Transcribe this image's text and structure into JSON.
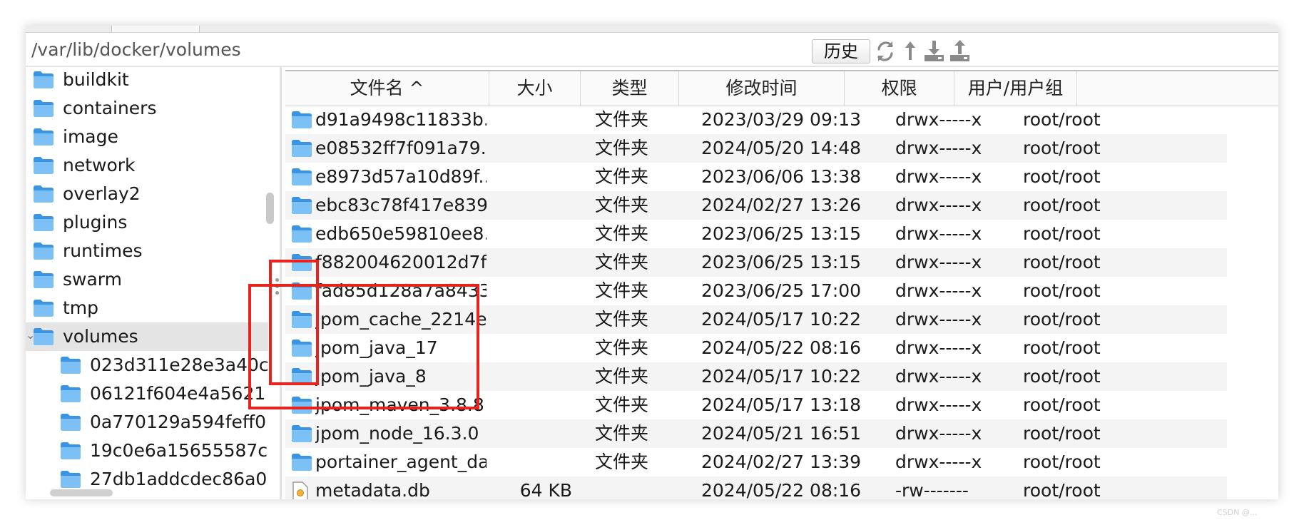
{
  "path_bar": {
    "path": "/var/lib/docker/volumes",
    "history_label": "历史"
  },
  "toolbar": {
    "icons": [
      "refresh-icon",
      "up-icon",
      "download-icon",
      "upload-icon"
    ]
  },
  "tree": [
    {
      "name": "buildkit",
      "level": 1
    },
    {
      "name": "containers",
      "level": 1
    },
    {
      "name": "image",
      "level": 1
    },
    {
      "name": "network",
      "level": 1
    },
    {
      "name": "overlay2",
      "level": 1
    },
    {
      "name": "plugins",
      "level": 1
    },
    {
      "name": "runtimes",
      "level": 1
    },
    {
      "name": "swarm",
      "level": 1
    },
    {
      "name": "tmp",
      "level": 1
    },
    {
      "name": "volumes",
      "level": 1,
      "selected": true,
      "expanded": true
    },
    {
      "name": "023d311e28e3a40c",
      "level": 2
    },
    {
      "name": "06121f604e4a5621",
      "level": 2
    },
    {
      "name": "0a770129a594feff0",
      "level": 2
    },
    {
      "name": "19c0e6a15655587c",
      "level": 2
    },
    {
      "name": "27db1addcdec86a0",
      "level": 2
    }
  ],
  "columns": {
    "name": "文件名 ^",
    "size": "大小",
    "type": "类型",
    "mtime": "修改时间",
    "perm": "权限",
    "owner": "用户/用户组"
  },
  "files": [
    {
      "name": "d91a9498c11833b...",
      "size": "",
      "type": "文件夹",
      "mtime": "2023/03/29 09:13",
      "perm": "drwx-----x",
      "owner": "root/root",
      "icon": "folder-icon"
    },
    {
      "name": "e08532ff7f091a79...",
      "size": "",
      "type": "文件夹",
      "mtime": "2024/05/20 14:48",
      "perm": "drwx-----x",
      "owner": "root/root",
      "icon": "folder-icon"
    },
    {
      "name": "e8973d57a10d89f...",
      "size": "",
      "type": "文件夹",
      "mtime": "2023/06/06 13:38",
      "perm": "drwx-----x",
      "owner": "root/root",
      "icon": "folder-icon"
    },
    {
      "name": "ebc83c78f417e839...",
      "size": "",
      "type": "文件夹",
      "mtime": "2024/02/27 13:26",
      "perm": "drwx-----x",
      "owner": "root/root",
      "icon": "folder-icon"
    },
    {
      "name": "edb650e59810ee8...",
      "size": "",
      "type": "文件夹",
      "mtime": "2023/06/25 13:15",
      "perm": "drwx-----x",
      "owner": "root/root",
      "icon": "folder-icon"
    },
    {
      "name": "f882004620012d7f...",
      "size": "",
      "type": "文件夹",
      "mtime": "2023/06/25 13:15",
      "perm": "drwx-----x",
      "owner": "root/root",
      "icon": "folder-icon"
    },
    {
      "name": "fad85d128a7a8433...",
      "size": "",
      "type": "文件夹",
      "mtime": "2023/06/25 17:00",
      "perm": "drwx-----x",
      "owner": "root/root",
      "icon": "folder-icon"
    },
    {
      "name": "jpom_cache_2214e...",
      "size": "",
      "type": "文件夹",
      "mtime": "2024/05/17 10:22",
      "perm": "drwx-----x",
      "owner": "root/root",
      "icon": "folder-icon"
    },
    {
      "name": "jpom_java_17",
      "size": "",
      "type": "文件夹",
      "mtime": "2024/05/22 08:16",
      "perm": "drwx-----x",
      "owner": "root/root",
      "icon": "folder-icon"
    },
    {
      "name": "jpom_java_8",
      "size": "",
      "type": "文件夹",
      "mtime": "2024/05/17 10:22",
      "perm": "drwx-----x",
      "owner": "root/root",
      "icon": "folder-icon"
    },
    {
      "name": "jpom_maven_3.8.8",
      "size": "",
      "type": "文件夹",
      "mtime": "2024/05/17 13:18",
      "perm": "drwx-----x",
      "owner": "root/root",
      "icon": "folder-icon"
    },
    {
      "name": "jpom_node_16.3.0",
      "size": "",
      "type": "文件夹",
      "mtime": "2024/05/21 16:51",
      "perm": "drwx-----x",
      "owner": "root/root",
      "icon": "folder-icon"
    },
    {
      "name": "portainer_agent_data",
      "size": "",
      "type": "文件夹",
      "mtime": "2024/02/27 13:39",
      "perm": "drwx-----x",
      "owner": "root/root",
      "icon": "folder-icon"
    },
    {
      "name": "metadata.db",
      "size": "64 KB",
      "type": "",
      "mtime": "2024/05/22 08:16",
      "perm": "-rw-------",
      "owner": "root/root",
      "icon": "file-icon"
    }
  ],
  "colors": {
    "folder": "#3a95e6",
    "folder_light": "#7cc0f5",
    "selection": "#e4e4e4",
    "alt_row": "#f4f4f4",
    "annotation": "#e8231d"
  },
  "watermark": "CSDN @..."
}
